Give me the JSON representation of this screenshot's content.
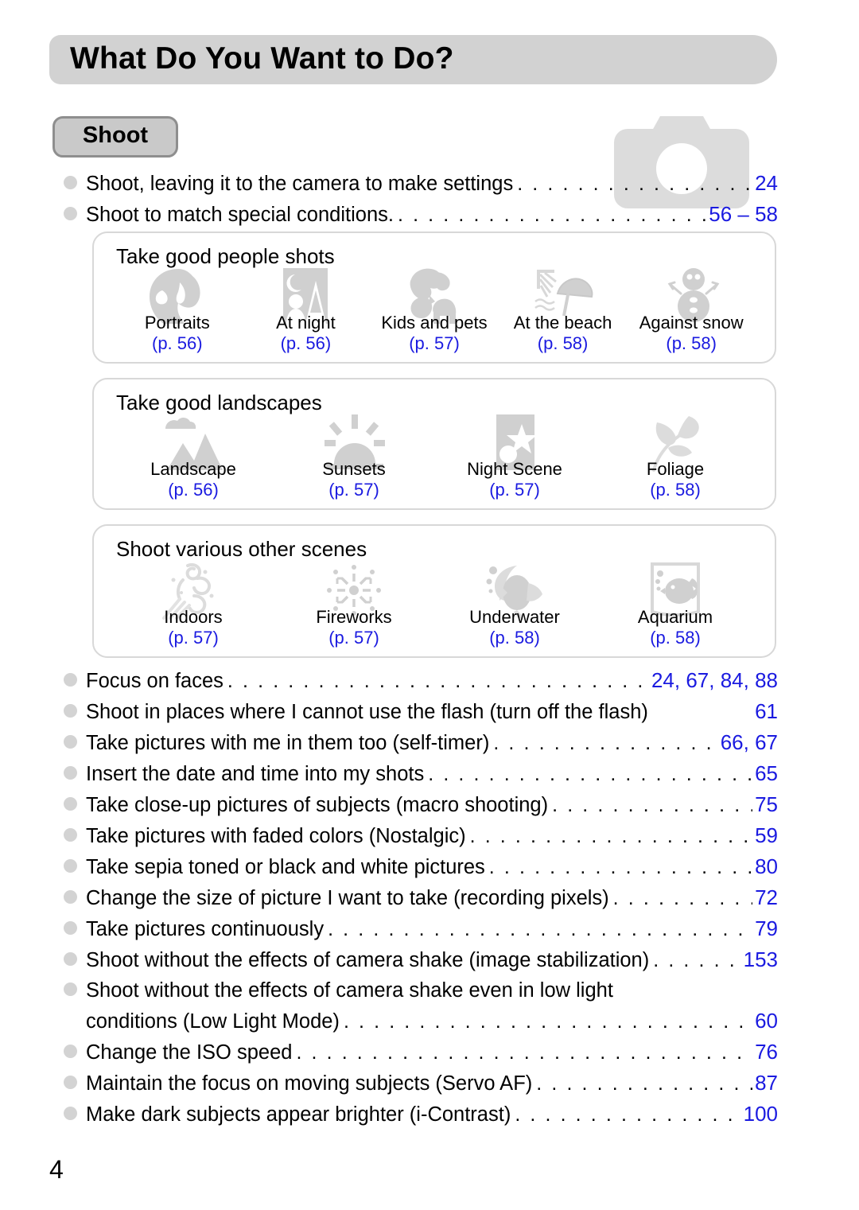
{
  "document": {
    "header_title": "What Do You Want to Do?",
    "page_number": "4",
    "accent_color": "#1a1ae0",
    "header_bg_color": "#d2d2d2",
    "icon_color": "#d0d0d0"
  },
  "section": {
    "tab_label": "Shoot",
    "camera_icon_name": "camera-watermark-icon"
  },
  "toc_top": [
    {
      "text": "Shoot, leaving it to the camera to make settings",
      "page": "24"
    },
    {
      "text": "Shoot to match special conditions.",
      "page": "56 – 58"
    }
  ],
  "panels": [
    {
      "title": "Take good people shots",
      "items": [
        {
          "label": "Portraits",
          "page": "(p. 56)",
          "icon": "portrait-head-icon"
        },
        {
          "label": "At night",
          "page": "(p. 56)",
          "icon": "night-portrait-icon"
        },
        {
          "label": "Kids and pets",
          "page": "(p. 57)",
          "icon": "kids-and-pets-icon"
        },
        {
          "label": "At the beach",
          "page": "(p. 58)",
          "icon": "beach-umbrella-icon"
        },
        {
          "label": "Against snow",
          "page": "(p. 58)",
          "icon": "snowman-icon"
        }
      ]
    },
    {
      "title": "Take good landscapes",
      "items": [
        {
          "label": "Landscape",
          "page": "(p. 56)",
          "icon": "mountain-landscape-icon"
        },
        {
          "label": "Sunsets",
          "page": "(p. 57)",
          "icon": "sunset-icon"
        },
        {
          "label": "Night Scene",
          "page": "(p. 57)",
          "icon": "night-scene-icon"
        },
        {
          "label": "Foliage",
          "page": "(p. 58)",
          "icon": "foliage-leaf-icon"
        }
      ]
    },
    {
      "title": "Shoot various other scenes",
      "items": [
        {
          "label": "Indoors",
          "page": "(p. 57)",
          "icon": "indoors-running-icon"
        },
        {
          "label": "Fireworks",
          "page": "(p. 57)",
          "icon": "fireworks-icon"
        },
        {
          "label": "Underwater",
          "page": "(p. 58)",
          "icon": "underwater-fish-icon"
        },
        {
          "label": "Aquarium",
          "page": "(p. 58)",
          "icon": "aquarium-tank-icon"
        }
      ]
    }
  ],
  "toc_bottom": [
    {
      "text": "Focus on faces",
      "page": "24, 67, 84, 88",
      "leader": true
    },
    {
      "text": "Shoot in places where I cannot use the flash (turn off the flash)",
      "page": "61",
      "leader": false
    },
    {
      "text": "Take pictures with me in them too (self-timer)",
      "page": "66, 67",
      "leader": true
    },
    {
      "text": "Insert the date and time into my shots",
      "page": "65",
      "leader": true
    },
    {
      "text": "Take close-up pictures of subjects (macro shooting)",
      "page": "75",
      "leader": true
    },
    {
      "text": "Take pictures with faded colors (Nostalgic)",
      "page": "59",
      "leader": true
    },
    {
      "text": "Take sepia toned or black and white pictures",
      "page": "80",
      "leader": true
    },
    {
      "text": "Change the size of picture I want to take (recording pixels)",
      "page": "72",
      "leader": true
    },
    {
      "text": "Take pictures continuously",
      "page": "79",
      "leader": true
    },
    {
      "text": "Shoot without the effects of camera shake (image stabilization)",
      "page": "153",
      "leader": true
    },
    {
      "text": "Shoot without the effects of camera shake even in low light",
      "text2": "conditions (Low Light Mode)",
      "page": "60",
      "leader": true,
      "wrapped": true
    },
    {
      "text": "Change the ISO speed",
      "page": "76",
      "leader": true
    },
    {
      "text": "Maintain the focus on moving subjects (Servo AF)",
      "page": "87",
      "leader": true
    },
    {
      "text": "Make dark subjects appear brighter (i-Contrast)",
      "page": "100",
      "leader": true
    }
  ]
}
